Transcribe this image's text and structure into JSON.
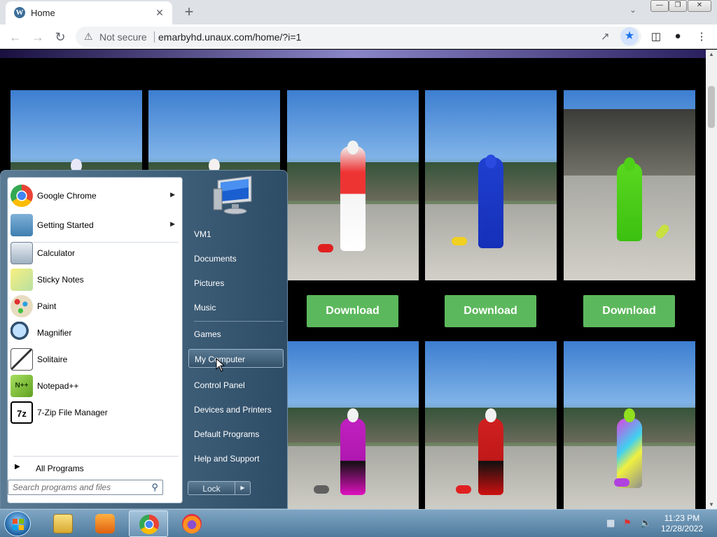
{
  "browser": {
    "tab_title": "Home",
    "favicon_letter": "W",
    "close_glyph": "✕",
    "newtab_glyph": "+",
    "tab_search_glyph": "⌄",
    "security_label": "Not secure",
    "url": "emarbyhd.unaux.com/home/?i=1"
  },
  "page": {
    "download_buttons": [
      "Download",
      "Download",
      "Download"
    ]
  },
  "start_menu": {
    "pinned": [
      {
        "label": "Google Chrome",
        "icon": "chrome-icon",
        "has_arrow": true
      },
      {
        "label": "Getting Started",
        "icon": "getting-started-icon",
        "has_arrow": true
      },
      {
        "label": "Calculator",
        "icon": "calculator-icon",
        "has_arrow": false
      },
      {
        "label": "Sticky Notes",
        "icon": "sticky-notes-icon",
        "has_arrow": false
      },
      {
        "label": "Paint",
        "icon": "paint-icon",
        "has_arrow": false
      },
      {
        "label": "Magnifier",
        "icon": "magnifier-icon",
        "has_arrow": false
      },
      {
        "label": "Solitaire",
        "icon": "solitaire-icon",
        "has_arrow": false
      },
      {
        "label": "Notepad++",
        "icon": "notepadpp-icon",
        "has_arrow": false
      },
      {
        "label": "7-Zip File Manager",
        "icon": "7zip-icon",
        "has_arrow": false
      }
    ],
    "icon_text": {
      "7zip": "7z",
      "notepadpp": "N++"
    },
    "all_programs": "All Programs",
    "search_placeholder": "Search programs and files",
    "right_items": [
      "VM1",
      "Documents",
      "Pictures",
      "Music",
      "Games",
      "My Computer",
      "Control Panel",
      "Devices and Printers",
      "Default Programs",
      "Help and Support"
    ],
    "hovered_item": "My Computer",
    "lock_label": "Lock",
    "lock_arrow": "▶"
  },
  "taskbar": {
    "time": "11:23 PM",
    "date": "12/28/2022",
    "apps": [
      "windows-explorer-icon",
      "media-player-icon",
      "chrome-icon",
      "firefox-icon"
    ],
    "active_app": "chrome-icon"
  },
  "colors": {
    "download_button": "#5cb85c",
    "taskbar": "#6a93b5",
    "start_menu_right": "#3e5e78"
  }
}
